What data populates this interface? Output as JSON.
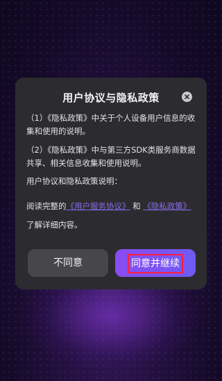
{
  "dialog": {
    "title": "用户协议与隐私政策",
    "close_icon": "close-icon",
    "paragraphs": {
      "p1": "（1）《隐私政策》中关于个人设备用户信息的收集和使用的说明。",
      "p2": "（2）《隐私政策》中与第三方SDK类服务商数据共享、相关信息收集和使用说明。",
      "p3": "用户协议和隐私政策说明："
    },
    "read_notice": {
      "prefix": "阅读完整的",
      "user_agreement_link": "《用户服务协议》",
      "and": "和",
      "privacy_policy_link": "《隐私政策》",
      "suffix": "了解详细内容。"
    },
    "buttons": {
      "disagree": "不同意",
      "agree": "同意并继续"
    }
  },
  "colors": {
    "dialog_bg": "#2c2c30",
    "link": "#8a6af0",
    "agree_gradient_start": "#8a4cf0",
    "agree_gradient_end": "#6f5bf5",
    "disagree_bg": "#47474b",
    "highlight_box": "#ff1f3d"
  }
}
